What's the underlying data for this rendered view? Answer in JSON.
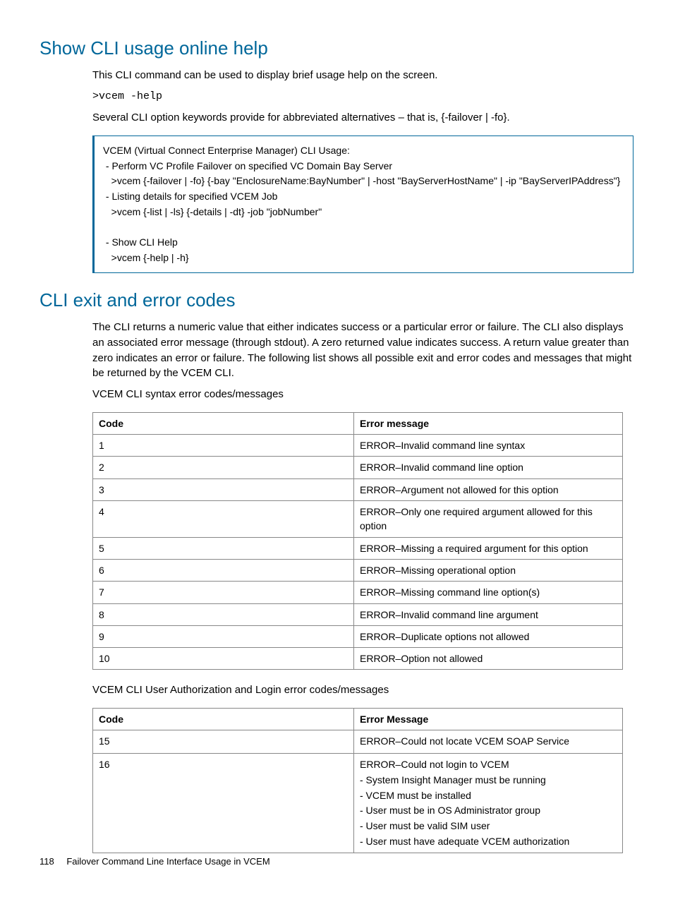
{
  "section1": {
    "title": "Show CLI usage online help",
    "intro": "This CLI command can be used to display brief usage help on the screen.",
    "cmd": ">vcem -help",
    "after_cmd": "Several CLI option keywords provide for abbreviated alternatives – that is, {-failover | -fo}.",
    "usage": "VCEM (Virtual Connect Enterprise Manager) CLI Usage:\n - Perform VC Profile Failover on specified VC Domain Bay Server\n   >vcem {-failover | -fo} {-bay \"EnclosureName:BayNumber\" | -host \"BayServerHostName\" | -ip \"BayServerIPAddress\"}\n - Listing details for specified VCEM Job\n   >vcem {-list | -ls} {-details | -dt} -job \"jobNumber\"\n\n - Show CLI Help\n   >vcem {-help | -h}"
  },
  "section2": {
    "title": "CLI exit and error codes",
    "intro": "The CLI returns a numeric value that either indicates success or a particular error or failure. The CLI also displays an associated error message (through stdout). A zero returned value indicates success. A return value greater than zero indicates an error or failure. The following list shows all possible exit and error codes and messages that might be returned by the VCEM CLI.",
    "table1_caption": "VCEM CLI syntax error codes/messages",
    "table1": {
      "h1": "Code",
      "h2": "Error message",
      "rows": [
        {
          "c": "1",
          "m": "ERROR–Invalid command line syntax"
        },
        {
          "c": "2",
          "m": "ERROR–Invalid command line option"
        },
        {
          "c": "3",
          "m": "ERROR–Argument not allowed for this option"
        },
        {
          "c": "4",
          "m": "ERROR–Only one required argument allowed for this option"
        },
        {
          "c": "5",
          "m": "ERROR–Missing a required argument for this option"
        },
        {
          "c": "6",
          "m": "ERROR–Missing operational option"
        },
        {
          "c": "7",
          "m": "ERROR–Missing command line option(s)"
        },
        {
          "c": "8",
          "m": "ERROR–Invalid command line argument"
        },
        {
          "c": "9",
          "m": "ERROR–Duplicate options not allowed"
        },
        {
          "c": "10",
          "m": "ERROR–Option not allowed"
        }
      ]
    },
    "table2_caption": "VCEM CLI User Authorization and Login error codes/messages",
    "table2": {
      "h1": "Code",
      "h2": "Error Message",
      "rows": [
        {
          "c": "15",
          "m": "ERROR–Could not locate VCEM SOAP Service"
        },
        {
          "c": "16",
          "m": "ERROR–Could not login to VCEM\n- System Insight Manager must be running\n- VCEM must be installed\n- User must be in OS Administrator group\n- User must be valid SIM user\n- User must have adequate VCEM authorization"
        }
      ]
    }
  },
  "footer": {
    "page": "118",
    "chapter": "Failover Command Line Interface Usage in VCEM"
  }
}
